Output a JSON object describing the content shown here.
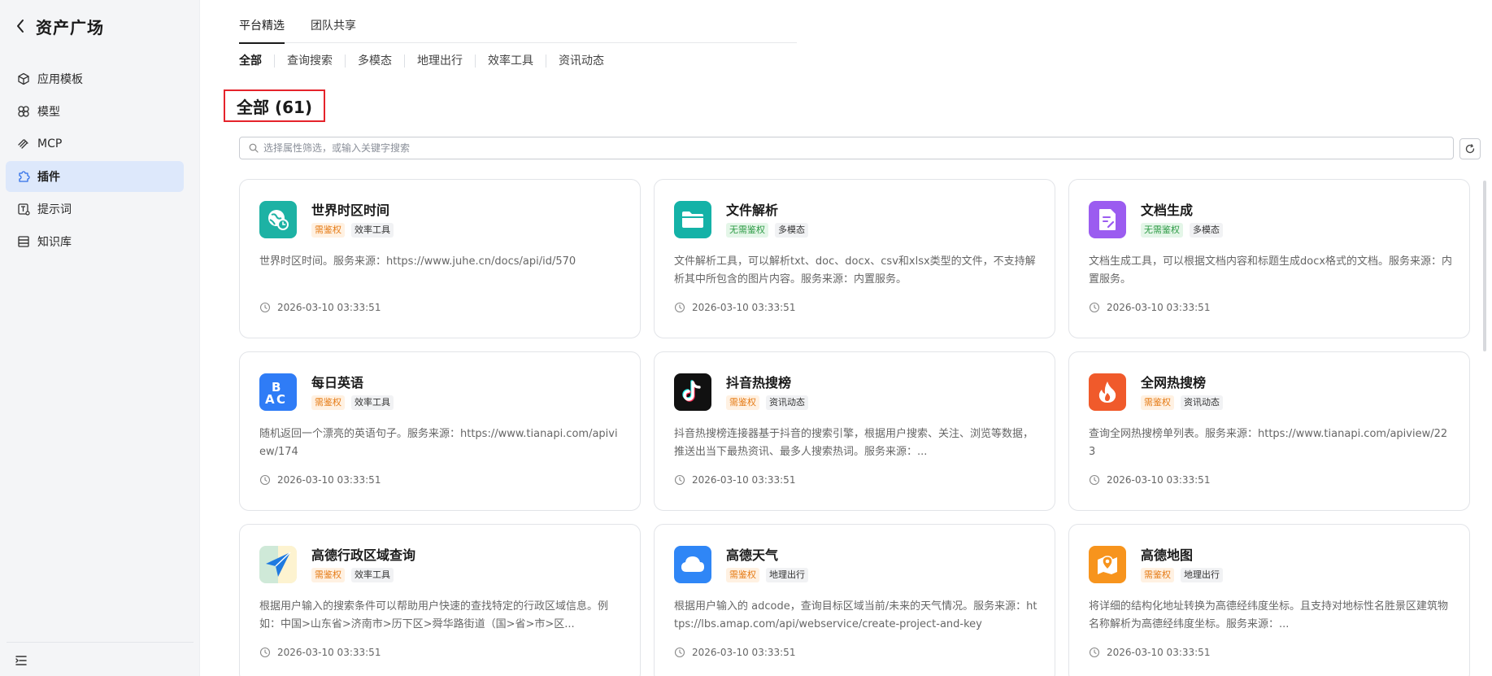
{
  "sidebar": {
    "title": "资产广场",
    "items": [
      {
        "label": "应用模板",
        "icon": "cube-icon",
        "active": false
      },
      {
        "label": "模型",
        "icon": "model-icon",
        "active": false
      },
      {
        "label": "MCP",
        "icon": "mcp-icon",
        "active": false
      },
      {
        "label": "插件",
        "icon": "plugin-icon",
        "active": true
      },
      {
        "label": "提示词",
        "icon": "prompt-icon",
        "active": false
      },
      {
        "label": "知识库",
        "icon": "database-icon",
        "active": false
      }
    ]
  },
  "tabs": [
    {
      "label": "平台精选",
      "active": true
    },
    {
      "label": "团队共享",
      "active": false
    }
  ],
  "filters": [
    {
      "label": "全部",
      "active": true
    },
    {
      "label": "查询搜索",
      "active": false
    },
    {
      "label": "多模态",
      "active": false
    },
    {
      "label": "地理出行",
      "active": false
    },
    {
      "label": "效率工具",
      "active": false
    },
    {
      "label": "资讯动态",
      "active": false
    }
  ],
  "section_title": "全部 (61)",
  "search": {
    "placeholder": "选择属性筛选，或输入关键字搜索",
    "value": ""
  },
  "cards": [
    {
      "name": "世界时区时间",
      "auth": "需鉴权",
      "auth_type": "auth",
      "category": "效率工具",
      "desc": "世界时区时间。服务来源：https://www.juhe.cn/docs/api/id/570",
      "time": "2026-03-10 03:33:51",
      "icon": "globe-clock-icon",
      "icon_color": "#1db2a4"
    },
    {
      "name": "文件解析",
      "auth": "无需鉴权",
      "auth_type": "noauth",
      "category": "多模态",
      "desc": "文件解析工具，可以解析txt、doc、docx、csv和xlsx类型的文件，不支持解析其中所包含的图片内容。服务来源：内置服务。",
      "time": "2026-03-10 03:33:51",
      "icon": "folder-icon",
      "icon_color": "#14b2a7"
    },
    {
      "name": "文档生成",
      "auth": "无需鉴权",
      "auth_type": "noauth",
      "category": "多模态",
      "desc": "文档生成工具，可以根据文档内容和标题生成docx格式的文档。服务来源：内置服务。",
      "time": "2026-03-10 03:33:51",
      "icon": "document-icon",
      "icon_color": "#9b5cf0"
    },
    {
      "name": "每日英语",
      "auth": "需鉴权",
      "auth_type": "auth",
      "category": "效率工具",
      "desc": "随机返回一个漂亮的英语句子。服务来源：https://www.tianapi.com/apiview/174",
      "time": "2026-03-10 03:33:51",
      "icon": "abc-icon",
      "icon_color": "#2f7cf6"
    },
    {
      "name": "抖音热搜榜",
      "auth": "需鉴权",
      "auth_type": "auth",
      "category": "资讯动态",
      "desc": "抖音热搜榜连接器基于抖音的搜索引擎，根据用户搜索、关注、浏览等数据，推送出当下最热资讯、最多人搜索热词。服务来源：...",
      "time": "2026-03-10 03:33:51",
      "icon": "tiktok-icon",
      "icon_color": "#111111"
    },
    {
      "name": "全网热搜榜",
      "auth": "需鉴权",
      "auth_type": "auth",
      "category": "资讯动态",
      "desc": "查询全网热搜榜单列表。服务来源：https://www.tianapi.com/apiview/223",
      "time": "2026-03-10 03:33:51",
      "icon": "fire-icon",
      "icon_color": "#f05a2b"
    },
    {
      "name": "高德行政区域查询",
      "auth": "需鉴权",
      "auth_type": "auth",
      "category": "效率工具",
      "desc": "根据用户输入的搜索条件可以帮助用户快速的查找特定的行政区域信息。例如：中国>山东省>济南市>历下区>舜华路街道（国>省>市>区...",
      "time": "2026-03-10 03:33:51",
      "icon": "paper-plane-icon",
      "icon_color": "#e8f4ee"
    },
    {
      "name": "高德天气",
      "auth": "需鉴权",
      "auth_type": "auth",
      "category": "地理出行",
      "desc": "根据用户输入的 adcode，查询目标区域当前/未来的天气情况。服务来源：https://lbs.amap.com/api/webservice/create-project-and-key",
      "time": "2026-03-10 03:33:51",
      "icon": "cloud-icon",
      "icon_color": "#2f86f6"
    },
    {
      "name": "高德地图",
      "auth": "需鉴权",
      "auth_type": "auth",
      "category": "地理出行",
      "desc": "将详细的结构化地址转换为高德经纬度坐标。且支持对地标性名胜景区建筑物名称解析为高德经纬度坐标。服务来源：...",
      "time": "2026-03-10 03:33:51",
      "icon": "map-pin-icon",
      "icon_color": "#f7941d"
    }
  ]
}
